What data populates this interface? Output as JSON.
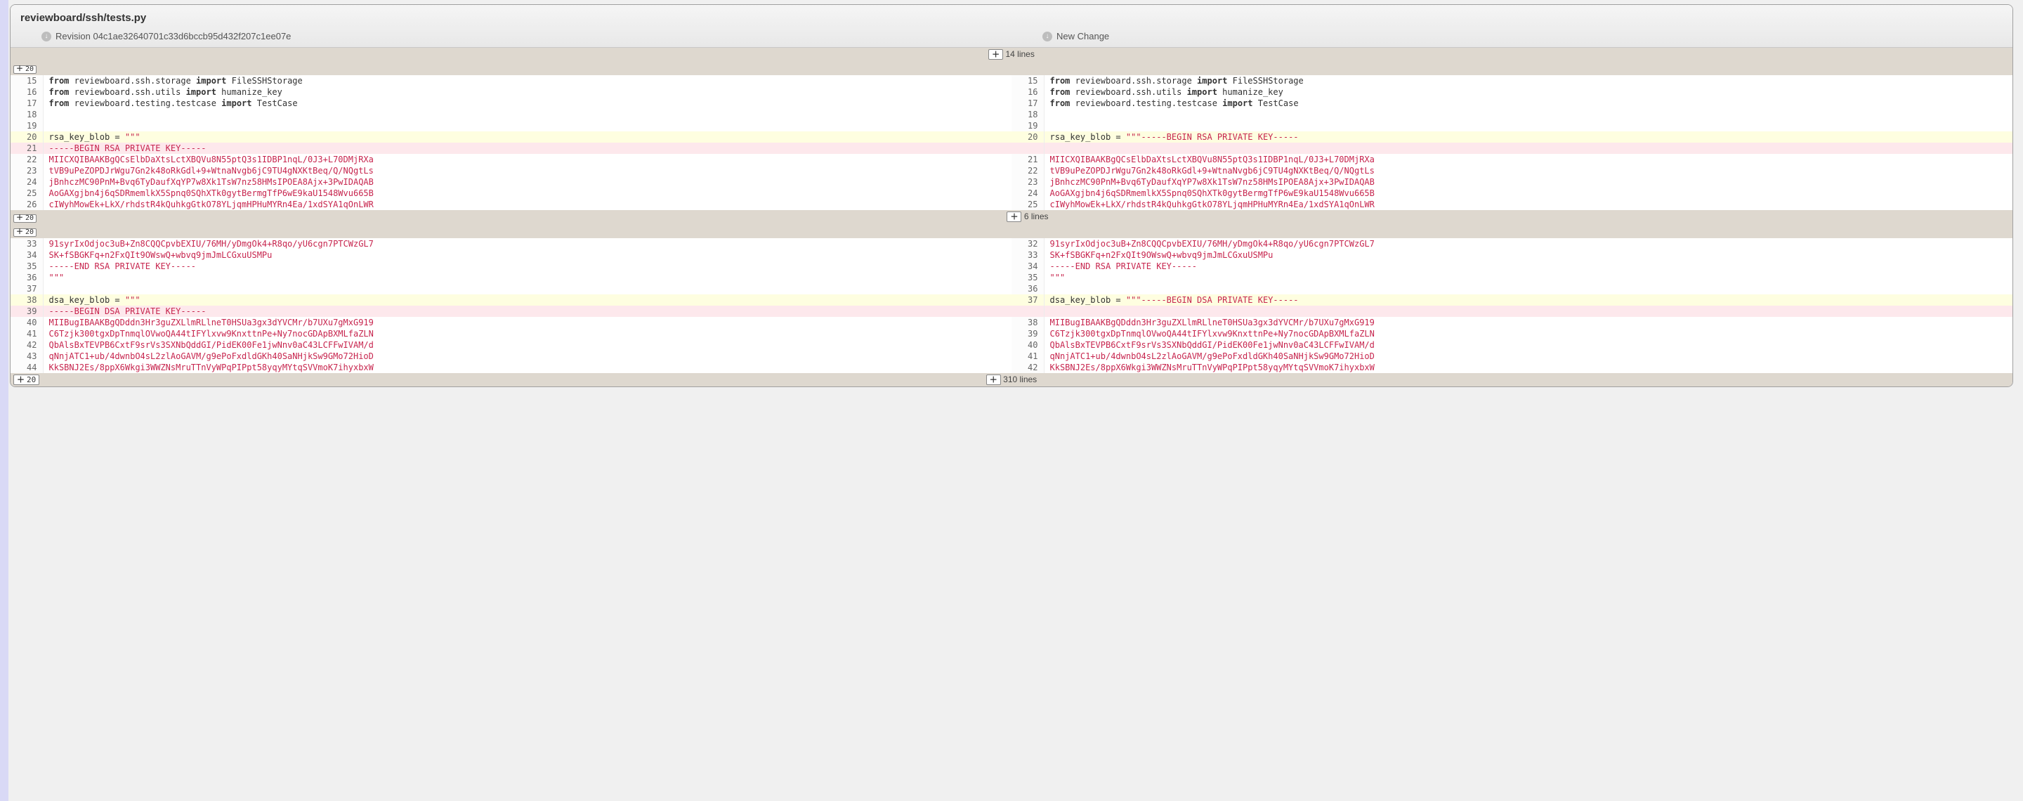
{
  "file_path": "reviewboard/ssh/tests.py",
  "revisions": {
    "left": "Revision 04c1ae32640701c33d6bccb95d432f207c1ee07e",
    "right": "New Change"
  },
  "expand_labels": {
    "twenty": "20"
  },
  "collapsed": {
    "top": "14 lines",
    "mid": "6 lines",
    "bottom": "310 lines"
  },
  "rows": [
    {
      "type": "equal",
      "l_no": "15",
      "r_no": "15",
      "l_parts": [
        [
          "kw",
          "from"
        ],
        [
          "",
          " reviewboard.ssh.storage "
        ],
        [
          "kw",
          "import"
        ],
        [
          "",
          " FileSSHStorage"
        ]
      ],
      "r_parts": [
        [
          "kw",
          "from"
        ],
        [
          "",
          " reviewboard.ssh.storage "
        ],
        [
          "kw",
          "import"
        ],
        [
          "",
          " FileSSHStorage"
        ]
      ]
    },
    {
      "type": "equal",
      "l_no": "16",
      "r_no": "16",
      "l_parts": [
        [
          "kw",
          "from"
        ],
        [
          "",
          " reviewboard.ssh.utils "
        ],
        [
          "kw",
          "import"
        ],
        [
          "",
          " humanize_key"
        ]
      ],
      "r_parts": [
        [
          "kw",
          "from"
        ],
        [
          "",
          " reviewboard.ssh.utils "
        ],
        [
          "kw",
          "import"
        ],
        [
          "",
          " humanize_key"
        ]
      ]
    },
    {
      "type": "equal",
      "l_no": "17",
      "r_no": "17",
      "l_parts": [
        [
          "kw",
          "from"
        ],
        [
          "",
          " reviewboard.testing.testcase "
        ],
        [
          "kw",
          "import"
        ],
        [
          "",
          " TestCase"
        ]
      ],
      "r_parts": [
        [
          "kw",
          "from"
        ],
        [
          "",
          " reviewboard.testing.testcase "
        ],
        [
          "kw",
          "import"
        ],
        [
          "",
          " TestCase"
        ]
      ]
    },
    {
      "type": "equal",
      "l_no": "18",
      "r_no": "18",
      "l_parts": [],
      "r_parts": []
    },
    {
      "type": "equal",
      "l_no": "19",
      "r_no": "19",
      "l_parts": [],
      "r_parts": []
    },
    {
      "type": "change",
      "l_no": "20",
      "r_no": "20",
      "l_parts": [
        [
          "",
          "rsa_key_blob = "
        ],
        [
          "str",
          "\"\"\""
        ]
      ],
      "r_parts": [
        [
          "",
          "rsa_key_blob = "
        ],
        [
          "str",
          "\"\"\"-----BEGIN RSA PRIVATE KEY-----"
        ]
      ]
    },
    {
      "type": "delete",
      "l_no": "21",
      "r_no": "",
      "l_parts": [
        [
          "str",
          "-----BEGIN RSA PRIVATE KEY-----"
        ]
      ],
      "r_parts": []
    },
    {
      "type": "equal",
      "l_no": "22",
      "r_no": "21",
      "l_parts": [
        [
          "str",
          "MIICXQIBAAKBgQCsElbDaXtsLctXBQVu8N55ptQ3s1IDBP1nqL/0J3+L70DMjRXa"
        ]
      ],
      "r_parts": [
        [
          "str",
          "MIICXQIBAAKBgQCsElbDaXtsLctXBQVu8N55ptQ3s1IDBP1nqL/0J3+L70DMjRXa"
        ]
      ]
    },
    {
      "type": "equal",
      "l_no": "23",
      "r_no": "22",
      "l_parts": [
        [
          "str",
          "tVB9uPeZOPDJrWgu7Gn2k48oRkGdl+9+WtnaNvgb6jC9TU4gNXKtBeq/Q/NQgtLs"
        ]
      ],
      "r_parts": [
        [
          "str",
          "tVB9uPeZOPDJrWgu7Gn2k48oRkGdl+9+WtnaNvgb6jC9TU4gNXKtBeq/Q/NQgtLs"
        ]
      ]
    },
    {
      "type": "equal",
      "l_no": "24",
      "r_no": "23",
      "l_parts": [
        [
          "str",
          "jBnhczMC90PnM+Bvq6TyDaufXqYP7w8Xk1TsW7nz58HMsIPOEA8Ajx+3PwIDAQAB"
        ]
      ],
      "r_parts": [
        [
          "str",
          "jBnhczMC90PnM+Bvq6TyDaufXqYP7w8Xk1TsW7nz58HMsIPOEA8Ajx+3PwIDAQAB"
        ]
      ]
    },
    {
      "type": "equal",
      "l_no": "25",
      "r_no": "24",
      "l_parts": [
        [
          "str",
          "AoGAXgjbn4j6qSDRmemlkX5Spnq0SQhXTk0gytBermgTfP6wE9kaU1548Wvu665B"
        ]
      ],
      "r_parts": [
        [
          "str",
          "AoGAXgjbn4j6qSDRmemlkX5Spnq0SQhXTk0gytBermgTfP6wE9kaU1548Wvu665B"
        ]
      ]
    },
    {
      "type": "equal",
      "l_no": "26",
      "r_no": "25",
      "l_parts": [
        [
          "str",
          "cIWyhMowEk+LkX/rhdstR4kQuhkgGtkO78YLjqmHPHuMYRn4Ea/1xdSYA1qOnLWR"
        ]
      ],
      "r_parts": [
        [
          "str",
          "cIWyhMowEk+LkX/rhdstR4kQuhkgGtkO78YLjqmHPHuMYRn4Ea/1xdSYA1qOnLWR"
        ]
      ]
    }
  ],
  "rows2": [
    {
      "type": "equal",
      "l_no": "33",
      "r_no": "32",
      "l_parts": [
        [
          "str",
          "91syrIxOdjoc3uB+Zn8CQQCpvbEXIU/76MH/yDmgOk4+R8qo/yU6cgn7PTCWzGL7"
        ]
      ],
      "r_parts": [
        [
          "str",
          "91syrIxOdjoc3uB+Zn8CQQCpvbEXIU/76MH/yDmgOk4+R8qo/yU6cgn7PTCWzGL7"
        ]
      ]
    },
    {
      "type": "equal",
      "l_no": "34",
      "r_no": "33",
      "l_parts": [
        [
          "str",
          "SK+fSBGKFq+n2FxQIt9OWswQ+wbvq9jmJmLCGxuUSMPu"
        ]
      ],
      "r_parts": [
        [
          "str",
          "SK+fSBGKFq+n2FxQIt9OWswQ+wbvq9jmJmLCGxuUSMPu"
        ]
      ]
    },
    {
      "type": "equal",
      "l_no": "35",
      "r_no": "34",
      "l_parts": [
        [
          "str",
          "-----END RSA PRIVATE KEY-----"
        ]
      ],
      "r_parts": [
        [
          "str",
          "-----END RSA PRIVATE KEY-----"
        ]
      ]
    },
    {
      "type": "equal",
      "l_no": "36",
      "r_no": "35",
      "l_parts": [
        [
          "str",
          "\"\"\""
        ]
      ],
      "r_parts": [
        [
          "str",
          "\"\"\""
        ]
      ]
    },
    {
      "type": "equal",
      "l_no": "37",
      "r_no": "36",
      "l_parts": [],
      "r_parts": []
    },
    {
      "type": "change",
      "l_no": "38",
      "r_no": "37",
      "l_parts": [
        [
          "",
          "dsa_key_blob = "
        ],
        [
          "str",
          "\"\"\""
        ]
      ],
      "r_parts": [
        [
          "",
          "dsa_key_blob = "
        ],
        [
          "str",
          "\"\"\"-----BEGIN DSA PRIVATE KEY-----"
        ]
      ]
    },
    {
      "type": "delete",
      "l_no": "39",
      "r_no": "",
      "l_parts": [
        [
          "str",
          "-----BEGIN DSA PRIVATE KEY-----"
        ]
      ],
      "r_parts": []
    },
    {
      "type": "equal",
      "l_no": "40",
      "r_no": "38",
      "l_parts": [
        [
          "str",
          "MIIBugIBAAKBgQDddn3Hr3guZXLlmRLlneT0HSUa3gx3dYVCMr/b7UXu7gMxG919"
        ]
      ],
      "r_parts": [
        [
          "str",
          "MIIBugIBAAKBgQDddn3Hr3guZXLlmRLlneT0HSUa3gx3dYVCMr/b7UXu7gMxG919"
        ]
      ]
    },
    {
      "type": "equal",
      "l_no": "41",
      "r_no": "39",
      "l_parts": [
        [
          "str",
          "C6Tzjk300tgxDpTnmqlOVwoQA44tIFYlxvw9KnxttnPe+Ny7nocGDApBXMLfaZLN"
        ]
      ],
      "r_parts": [
        [
          "str",
          "C6Tzjk300tgxDpTnmqlOVwoQA44tIFYlxvw9KnxttnPe+Ny7nocGDApBXMLfaZLN"
        ]
      ]
    },
    {
      "type": "equal",
      "l_no": "42",
      "r_no": "40",
      "l_parts": [
        [
          "str",
          "QbAlsBxTEVPB6CxtF9srVs3SXNbQddGI/PidEK00Fe1jwNnv0aC43LCFFwIVAM/d"
        ]
      ],
      "r_parts": [
        [
          "str",
          "QbAlsBxTEVPB6CxtF9srVs3SXNbQddGI/PidEK00Fe1jwNnv0aC43LCFFwIVAM/d"
        ]
      ]
    },
    {
      "type": "equal",
      "l_no": "43",
      "r_no": "41",
      "l_parts": [
        [
          "str",
          "qNnjATC1+ub/4dwnbO4sL2zlAoGAVM/g9ePoFxdldGKh40SaNHjkSw9GMo72HioD"
        ]
      ],
      "r_parts": [
        [
          "str",
          "qNnjATC1+ub/4dwnbO4sL2zlAoGAVM/g9ePoFxdldGKh40SaNHjkSw9GMo72HioD"
        ]
      ]
    },
    {
      "type": "equal",
      "l_no": "44",
      "r_no": "42",
      "l_parts": [
        [
          "str",
          "KkSBNJ2Es/8ppX6Wkgi3WWZNsMruTTnVyWPqPIPpt58yqyMYtqSVVmoK7ihyxbxW"
        ]
      ],
      "r_parts": [
        [
          "str",
          "KkSBNJ2Es/8ppX6Wkgi3WWZNsMruTTnVyWPqPIPpt58yqyMYtqSVVmoK7ihyxbxW"
        ]
      ]
    }
  ]
}
